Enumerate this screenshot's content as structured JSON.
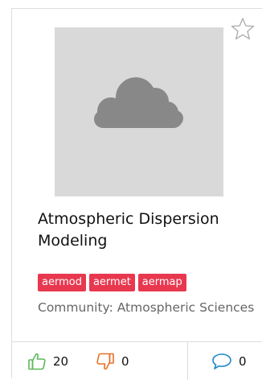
{
  "card": {
    "title": "Atmospheric Dispersion Modeling",
    "tags": [
      "aermod",
      "aermet",
      "aermap"
    ],
    "community": "Community: Atmospheric Sciences",
    "likes": "20",
    "dislikes": "0",
    "comments": "0",
    "icons": {
      "favorite": "star-outline-icon",
      "placeholder": "cloud-icon",
      "like": "thumbs-up-icon",
      "dislike": "thumbs-down-icon",
      "comment": "speech-bubble-icon"
    }
  },
  "colors": {
    "tag_background": "#e8384f",
    "like_icon": "#5cb85c",
    "dislike_icon": "#e8702a",
    "comment_icon": "#1e88c9",
    "thumbnail_background": "#d9d9d9",
    "cloud": "#888888"
  }
}
